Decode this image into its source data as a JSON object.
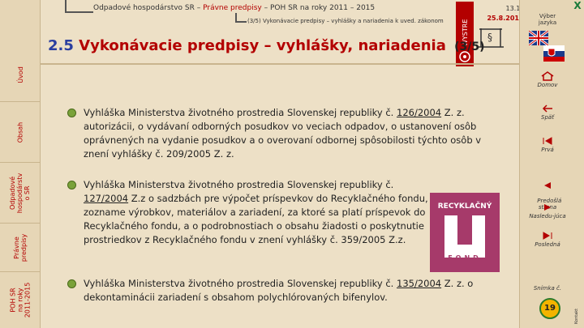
{
  "header": {
    "breadcrumb_prefix": "Odpadové hospodárstvo SR  –  ",
    "breadcrumb_highlight": "Právne predpisy",
    "breadcrumb_suffix": "  –  POH SR na roky 2011 – 2015",
    "sub_breadcrumb": "(3/5) Vykonávacie predpisy – vyhlášky a nariadenia k uved. zákonom",
    "version": "13.11",
    "date": "25.8.2013",
    "logo_text": "WYSTRE"
  },
  "title": {
    "number": "2.5",
    "text": "Vykonávacie predpisy – vyhlášky, nariadenia",
    "page": "(3/5)"
  },
  "sidebar": {
    "items": [
      {
        "label": "Úvod"
      },
      {
        "label": "Obsah"
      },
      {
        "label": "Odpadové\nhospodárstv\no SR"
      },
      {
        "label": "Právne\npredpisy"
      },
      {
        "label": "POH SR\nna roky\n2011-2015"
      }
    ]
  },
  "right_panel": {
    "close": "X",
    "language_label": "Výber\njazyka",
    "nav": [
      {
        "label": "Domov"
      },
      {
        "label": "Späť"
      },
      {
        "label": "Prvá"
      },
      {
        "label": "Predošlá\nstrana"
      },
      {
        "label": "Nasledu-júca"
      },
      {
        "label": "Posledná"
      },
      {
        "label": "Snímka č."
      }
    ],
    "slide_number": "19",
    "tiny": "Kontakt"
  },
  "bullets": [
    {
      "pre": "Vyhláška Ministerstva životného prostredia Slovenskej republiky č. ",
      "link": "126/2004",
      "post": " Z. z. autorizácii, o vydávaní odborných posudkov vo veciach odpadov, o ustanovení osôb oprávnených na vydanie posudkov a o overovaní odbornej spôsobilosti týchto osôb v znení vyhlášky č. 209/2005 Z. z."
    },
    {
      "pre": "Vyhláška Ministerstva životného prostredia Slovenskej republiky č. ",
      "link": "127/2004",
      "post": " Z.z o sadzbách pre výpočet príspevkov do Recyklačného fondu, o zozname výrobkov, materiálov a zariadení, za ktoré sa platí príspevok do Recyklačného fondu, a o podrobnostiach o obsahu žiadosti o poskytnutie prostriedkov z Recyklačného fondu v znení vyhlášky č. 359/2005 Z.z."
    },
    {
      "pre": "Vyhláška Ministerstva životného prostredia Slovenskej republiky č. ",
      "link": "135/2004",
      "post": " Z. z. o dekontaminácii zariadení s obsahom polychlórovaných bifenylov."
    }
  ],
  "fund_logo": {
    "top": "RECYKLAČNÝ",
    "bottom": "FOND"
  },
  "colors": {
    "background": "#ede0c6",
    "accent_red": "#b30000",
    "title_blue": "#2a3ea0",
    "bullet_green": "#7aa23a",
    "fund_purple": "#a63a6a"
  }
}
